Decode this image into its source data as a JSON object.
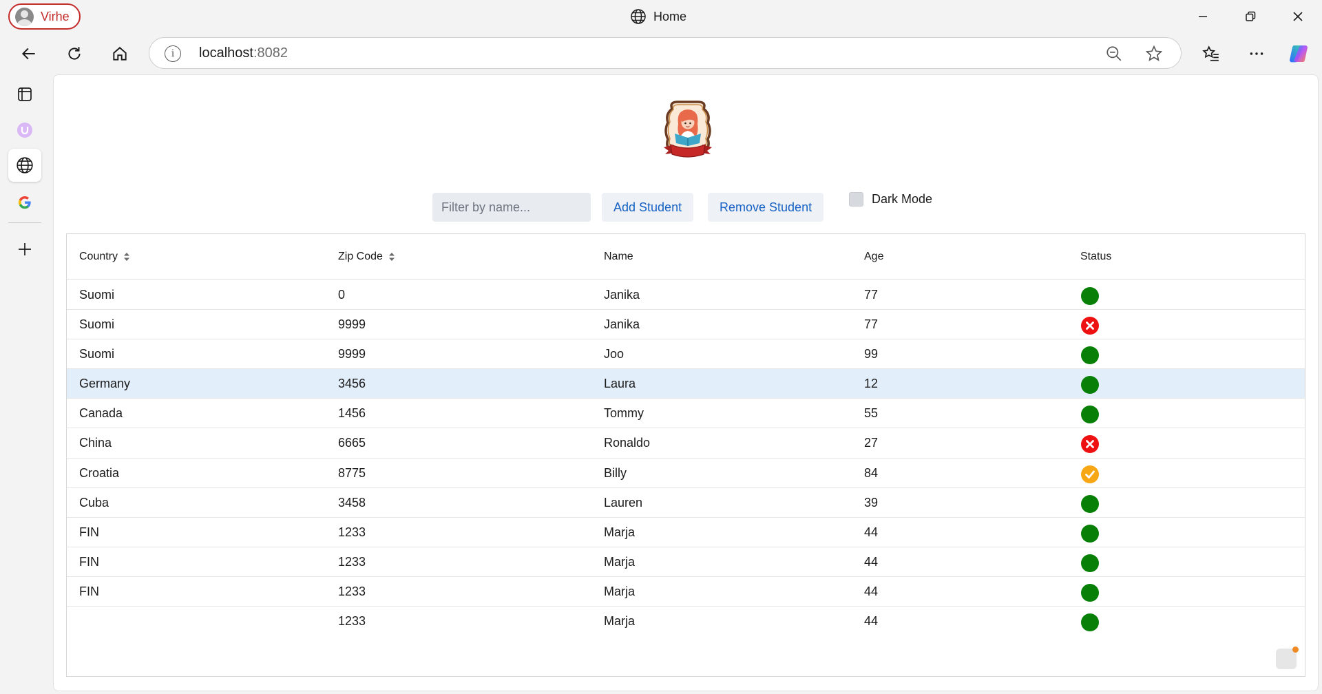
{
  "browser": {
    "profile_name": "Virhe",
    "tab_title": "Home",
    "url_host": "localhost",
    "url_port": ":8082"
  },
  "toolbar": {
    "filter_placeholder": "Filter by name...",
    "add_label": "Add Student",
    "remove_label": "Remove Student",
    "dark_mode_label": "Dark Mode",
    "dark_mode_checked": false
  },
  "table": {
    "headers": {
      "country": "Country",
      "zip": "Zip Code",
      "name": "Name",
      "age": "Age",
      "status": "Status"
    },
    "rows": [
      {
        "country": "Suomi",
        "zip": "0",
        "name": "Janika",
        "age": "77",
        "status": "active"
      },
      {
        "country": "Suomi",
        "zip": "9999",
        "name": "Janika",
        "age": "77",
        "status": "error"
      },
      {
        "country": "Suomi",
        "zip": "9999",
        "name": "Joo",
        "age": "99",
        "status": "active"
      },
      {
        "country": "Germany",
        "zip": "3456",
        "name": "Laura",
        "age": "12",
        "status": "active",
        "selected": true
      },
      {
        "country": "Canada",
        "zip": "1456",
        "name": "Tommy",
        "age": "55",
        "status": "active"
      },
      {
        "country": "China",
        "zip": "6665",
        "name": "Ronaldo",
        "age": "27",
        "status": "error"
      },
      {
        "country": "Croatia",
        "zip": "8775",
        "name": "Billy",
        "age": "84",
        "status": "checked"
      },
      {
        "country": "Cuba",
        "zip": "3458",
        "name": "Lauren",
        "age": "39",
        "status": "active"
      },
      {
        "country": "FIN",
        "zip": "1233",
        "name": "Marja",
        "age": "44",
        "status": "active"
      },
      {
        "country": "FIN",
        "zip": "1233",
        "name": "Marja",
        "age": "44",
        "status": "active"
      },
      {
        "country": "FIN",
        "zip": "1233",
        "name": "Marja",
        "age": "44",
        "status": "active"
      },
      {
        "country": "",
        "zip": "1233",
        "name": "Marja",
        "age": "44",
        "status": "active"
      }
    ]
  },
  "colors": {
    "status_active": "#088008",
    "status_error": "#ee1111",
    "status_checked": "#f7a614",
    "accent_link": "#1762c4",
    "selected_row": "#e3eefb",
    "profile_accent": "#c42b2b"
  },
  "icons": {
    "status_active": "green-dot-icon",
    "status_error": "red-x-circle-icon",
    "status_checked": "orange-check-circle-icon"
  }
}
